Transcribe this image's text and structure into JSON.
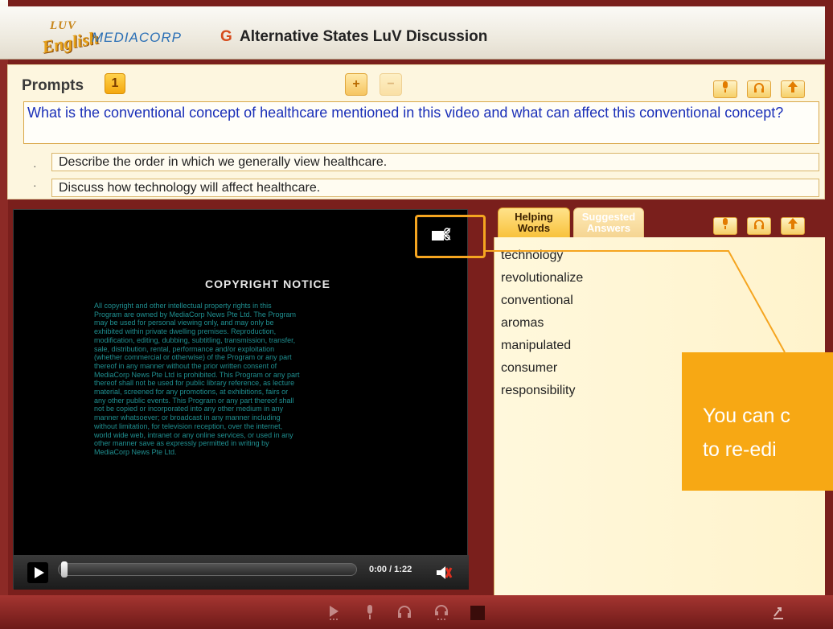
{
  "header": {
    "logo_top": "LUV",
    "logo_main": "English",
    "brand": "MEDIACORP",
    "title_icon": "G",
    "title": "Alternative States LuV Discussion"
  },
  "prompts": {
    "label": "Prompts",
    "count": "1",
    "add_label": "+",
    "remove_label": "−",
    "question": "What is the conventional concept of healthcare mentioned in this video and what can affect this conventional concept?",
    "sub_prompts": [
      "Describe the order in which we generally view healthcare.",
      "Discuss how technology will affect healthcare."
    ],
    "bullet": "·"
  },
  "video": {
    "notice_title": "COPYRIGHT NOTICE",
    "notice_lines": [
      "All copyright and other intellectual property rights in this",
      "Program are owned by MediaCorp News Pte Ltd. The Program",
      "may be used for personal viewing only, and may only be",
      "exhibited within private dwelling premises. Reproduction,",
      "modification, editing, dubbing, subtitling, transmission, transfer,",
      "sale, distribution, rental, performance and/or exploitation",
      "(whether commercial or otherwise) of the Program or any part",
      "thereof in any manner without the prior written consent of",
      "MediaCorp News Pte Ltd is prohibited. This Program or any part",
      "thereof shall not be used for public library reference, as lecture",
      "material, screened for any promotions, at exhibitions, fairs or",
      "any other public events. This Program or any part thereof shall",
      "not be copied or incorporated into any other medium in any",
      "manner whatsoever; or broadcast in any manner including",
      "without limitation, for television reception, over the internet,",
      "world wide web, intranet or any online services, or used in any",
      "other manner save as expressly permitted in writing by",
      "MediaCorp News Pte Ltd."
    ],
    "time": "0:00 / 1:22",
    "progress": 0.0
  },
  "tabs": [
    {
      "label_line1": "Helping",
      "label_line2": "Words"
    },
    {
      "label_line1": "Suggested",
      "label_line2": "Answers"
    }
  ],
  "helping_words": [
    "technology",
    "revolutionalize",
    "conventional",
    "aromas",
    "manipulated",
    "consumer",
    "responsibility"
  ],
  "tooltip": {
    "line1": "You can c",
    "line2": "to re-edi"
  },
  "colors": {
    "accent": "#f7a814",
    "question_text": "#1a2fb8",
    "frame": "#7a1f1c"
  }
}
